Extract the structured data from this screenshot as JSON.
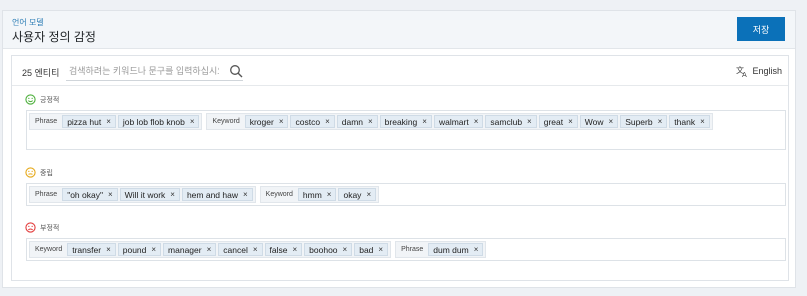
{
  "header": {
    "breadcrumb": "언어 모델",
    "title": "사용자 정의 감정",
    "save_label": "저장"
  },
  "toolbar": {
    "entity_count": "25 엔티티",
    "search_placeholder": "검색하려는 키워드나 문구를 입력하십시오",
    "language_label": "English"
  },
  "colors": {
    "primary_button": "#0b71b9",
    "positive": "#4caf3a",
    "neutral": "#e6a817",
    "negative": "#e23b3b"
  },
  "sections": [
    {
      "label": "긍정적",
      "icon": "smile-face-icon",
      "groups": [
        {
          "type": "Phrase",
          "items": [
            "pizza hut",
            "job lob flob knob"
          ]
        },
        {
          "type": "Keyword",
          "items": [
            "kroger",
            "costco",
            "damn",
            "breaking",
            "walmart",
            "samclub",
            "great",
            "Wow",
            "Superb",
            "thank"
          ]
        }
      ]
    },
    {
      "label": "중립",
      "icon": "neutral-face-icon",
      "groups": [
        {
          "type": "Phrase",
          "items": [
            "\"oh okay\"",
            "Will it work",
            "hem and haw"
          ]
        },
        {
          "type": "Keyword",
          "items": [
            "hmm",
            "okay"
          ]
        }
      ]
    },
    {
      "label": "부정적",
      "icon": "sad-face-icon",
      "groups": [
        {
          "type": "Keyword",
          "items": [
            "transfer",
            "pound",
            "manager",
            "cancel",
            "false",
            "boohoo",
            "bad"
          ]
        },
        {
          "type": "Phrase",
          "items": [
            "dum dum"
          ]
        }
      ]
    }
  ],
  "chip_remove_symbol": "×"
}
